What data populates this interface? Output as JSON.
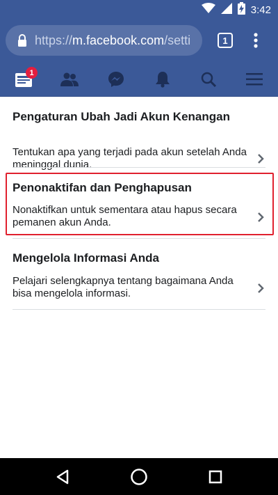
{
  "status_bar": {
    "time": "3:42",
    "icons": [
      "wifi-icon",
      "cell-signal-icon",
      "battery-charging-icon"
    ]
  },
  "browser": {
    "url_prefix": "https://",
    "url_domain": "m.facebook.com",
    "url_path": "/setti",
    "tab_count": "1",
    "icons": [
      "lock-icon",
      "overflow-menu-icon"
    ]
  },
  "fb_nav": {
    "items": [
      {
        "icon": "news-feed-icon",
        "badge": "1"
      },
      {
        "icon": "friends-icon"
      },
      {
        "icon": "messenger-icon"
      },
      {
        "icon": "notifications-bell-icon"
      },
      {
        "icon": "search-icon"
      },
      {
        "icon": "hamburger-menu-icon"
      }
    ],
    "colors": {
      "bar": "#3b5998",
      "badge": "#e41e3f"
    }
  },
  "settings": {
    "items": [
      {
        "title": "Pengaturan Ubah Jadi Akun Kenangan",
        "description": "Tentukan apa yang terjadi pada akun setelah Anda meninggal dunia."
      },
      {
        "title": "Penonaktifan dan Penghapusan",
        "description": "Nonaktifkan untuk sementara atau hapus secara pemanen akun Anda.",
        "highlighted": true
      },
      {
        "title": "Mengelola Informasi Anda",
        "description": "Pelajari selengkapnya tentang bagaimana Anda bisa mengelola informasi."
      }
    ],
    "highlight_color": "#e0202e"
  },
  "android_nav": {
    "icons": [
      "back-icon",
      "home-icon",
      "recents-icon"
    ]
  }
}
